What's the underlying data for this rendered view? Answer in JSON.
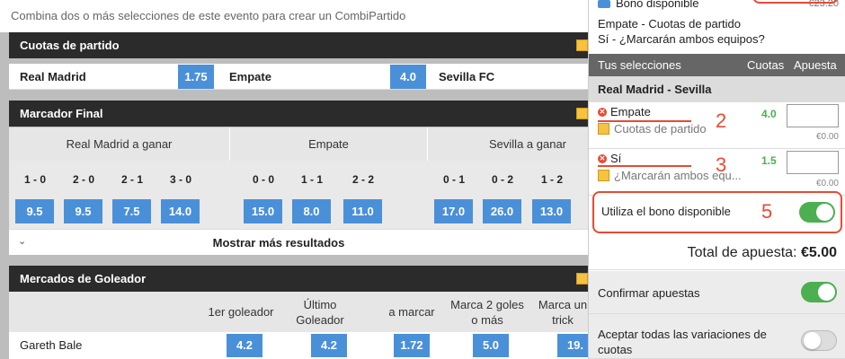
{
  "hint": "Combina dos o más selecciones de este evento para crear un CombiPartido",
  "match_odds": {
    "title": "Cuotas de partido",
    "home": {
      "label": "Real Madrid",
      "odd": "1.75"
    },
    "draw": {
      "label": "Empate",
      "odd": "4.0"
    },
    "away": {
      "label": "Sevilla FC",
      "odd": ""
    }
  },
  "final_score": {
    "title": "Marcador Final",
    "groups": [
      {
        "label": "Real Madrid a ganar",
        "scores": [
          "1 - 0",
          "2 - 0",
          "2 - 1",
          "3 - 0"
        ],
        "odds": [
          "9.5",
          "9.5",
          "7.5",
          "14.0"
        ]
      },
      {
        "label": "Empate",
        "scores": [
          "0 - 0",
          "1 - 1",
          "2 - 2"
        ],
        "odds": [
          "15.0",
          "8.0",
          "11.0"
        ]
      },
      {
        "label": "Sevilla a ganar",
        "scores": [
          "0 - 1",
          "0 - 2",
          "1 - 2"
        ],
        "odds": [
          "17.0",
          "26.0",
          "13.0"
        ]
      }
    ],
    "more": "Mostrar más resultados"
  },
  "scorers": {
    "title": "Mercados de Goleador",
    "columns": [
      "1er goleador",
      "Último Goleador",
      "a marcar",
      "Marca 2 goles o más",
      "Marca un trick"
    ],
    "rows": [
      {
        "name": "Gareth Bale",
        "odds": [
          "4.2",
          "4.2",
          "1.72",
          "5.0",
          "19."
        ]
      }
    ]
  },
  "slip": {
    "bono": {
      "label": "Bono disponible",
      "amount": "€23.20"
    },
    "combi_lines": [
      "Empate - Cuotas de partido",
      "Sí - ¿Marcarán ambos equipos?"
    ],
    "header": {
      "selections": "Tus selecciones",
      "odds": "Cuotas",
      "stake": "Apuesta"
    },
    "event": "Real Madrid - Sevilla",
    "selections": [
      {
        "pick": "Empate",
        "market": "Cuotas de partido",
        "odds": "4.0",
        "stake_eur": "€0.00",
        "annotation": "2"
      },
      {
        "pick": "Sí",
        "market": "¿Marcarán ambos equ...",
        "odds": "1.5",
        "stake_eur": "€0.00",
        "annotation": "3"
      }
    ],
    "bonus": {
      "label": "Utiliza el bono disponible",
      "annotation": "5",
      "enabled": true
    },
    "total": {
      "label": "Total de apuesta:",
      "value": "€5.00"
    },
    "confirm": {
      "label": "Confirmar apuestas",
      "enabled": true
    },
    "accept_changes": {
      "label": "Aceptar todas las variaciones de cuotas",
      "enabled": false
    }
  },
  "colors": {
    "odd_blue": "#4a90d9",
    "header_dark": "#2b2b2b",
    "toggle_green": "#4caf50",
    "annotation_red": "#e64b34"
  }
}
